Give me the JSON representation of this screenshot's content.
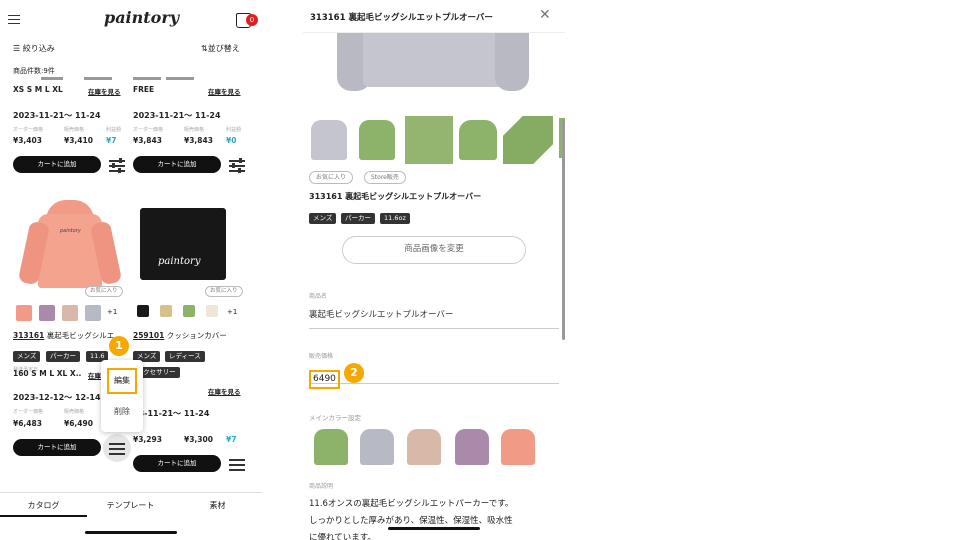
{
  "left": {
    "logo": "paintory",
    "cart_badge": "0",
    "filter_label": "絞り込み",
    "sort_label": "並び替え",
    "count_label": "商品件数:9件",
    "top": {
      "a": {
        "sizes": "XS S M L XL",
        "stock": "在庫を見る",
        "date": "2023-11-21〜 11-24",
        "h1": "オーダー価格",
        "h2": "販売価格",
        "h3": "利益額",
        "p1": "¥3,403",
        "p2": "¥3,410",
        "p3": "¥7",
        "cart": "カートに追加"
      },
      "b": {
        "sizes": "FREE",
        "stock": "在庫を見る",
        "date": "2023-11-21〜 11-24",
        "h1": "オーダー価格",
        "h2": "販売価格",
        "h3": "利益額",
        "p1": "¥3,843",
        "p2": "¥3,843",
        "p3": "¥0",
        "cart": "カートに追加"
      }
    },
    "p1": {
      "fav": "お気に入り",
      "more": "+1",
      "code": "313161",
      "name": "裏起毛ビッグシルエ",
      "tags": [
        "メンズ",
        "パーカー",
        "11.6"
      ],
      "sizes": "160 S M L XL X..",
      "stock": "在庫",
      "date_label": "発送予定日",
      "date": "2023-12-12〜 12-14",
      "h1": "オーダー価格",
      "h2": "販売価格",
      "p1": "¥6,483",
      "p2": "¥6,490",
      "cart": "カートに追加"
    },
    "p2": {
      "fav": "お気に入り",
      "more": "+1",
      "code": "259101",
      "name": "クッションカバー",
      "tags": [
        "メンズ",
        "レディース",
        "アクセサリー"
      ],
      "sizes": "EE",
      "stock": "在庫を見る",
      "date": "23-11-21〜 11-24",
      "p1": "¥3,293",
      "p2": "¥3,300",
      "p3": "¥7",
      "cart": "カートに追加",
      "logo": "paintory"
    },
    "menu": {
      "edit": "編集",
      "delete": "削除"
    },
    "badge1": "1",
    "tabs": {
      "catalog": "カタログ",
      "template": "テンプレート",
      "material": "素材"
    }
  },
  "right": {
    "title": "313161 裏起毛ビッグシルエットプルオーバー",
    "fav": "お気に入り",
    "store": "Store販売",
    "product_title": "313161 裏起毛ビッグシルエットプルオーバー",
    "tags": [
      "メンズ",
      "パーカー",
      "11.6oz"
    ],
    "change_btn": "商品画像を変更",
    "name_label": "商品名",
    "name_value": "裏起毛ビッグシルエットプルオーバー",
    "price_label": "販売価格",
    "price_value": "6490",
    "badge2": "2",
    "color_label": "メインカラー設定",
    "desc_label": "商品説明",
    "desc1": "11.6オンスの裏起毛ビッグシルエットパーカーです。",
    "desc2": "しっかりとした厚みがあり、保温性、保湿性、吸水性",
    "desc3": "に優れています。"
  },
  "colors": {
    "accent": "#f5a800",
    "green": "#8db26a",
    "grey": "#b7b9c4",
    "beige": "#d8b8a8",
    "purple": "#a98aab",
    "salmon": "#f19a85"
  }
}
